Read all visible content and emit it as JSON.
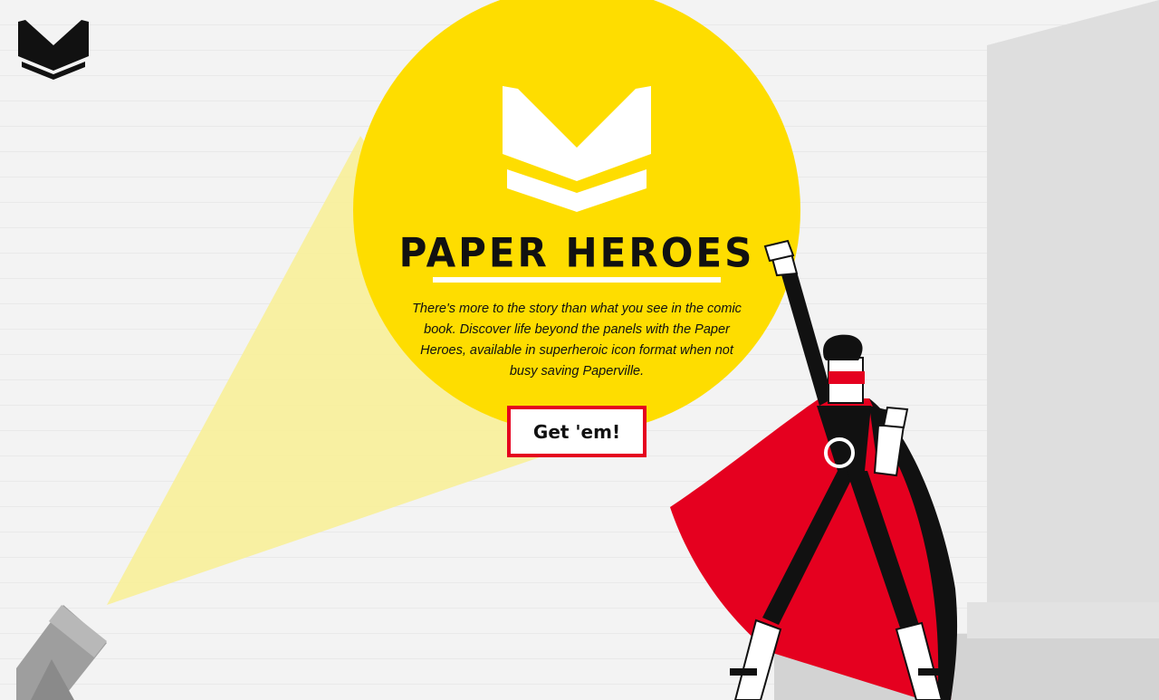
{
  "hero": {
    "title": "PAPER HEROES",
    "description": "There's more to the story than what you see in the comic book. Discover life beyond the panels with the Paper Heroes, available in superheroic icon format when not busy saving Paperville.",
    "cta_label": "Get 'em!"
  },
  "icons": {
    "logo": "book-chevron-logo-icon",
    "emblem": "book-chevron-emblem-icon",
    "spotlight": "spotlight-lamp-icon"
  },
  "colors": {
    "background": "#f3f3f3",
    "yellow": "#fedd00",
    "beam": "#f8ef99",
    "red": "#e5001f",
    "black": "#111111",
    "wall": "#d9d9d9"
  }
}
